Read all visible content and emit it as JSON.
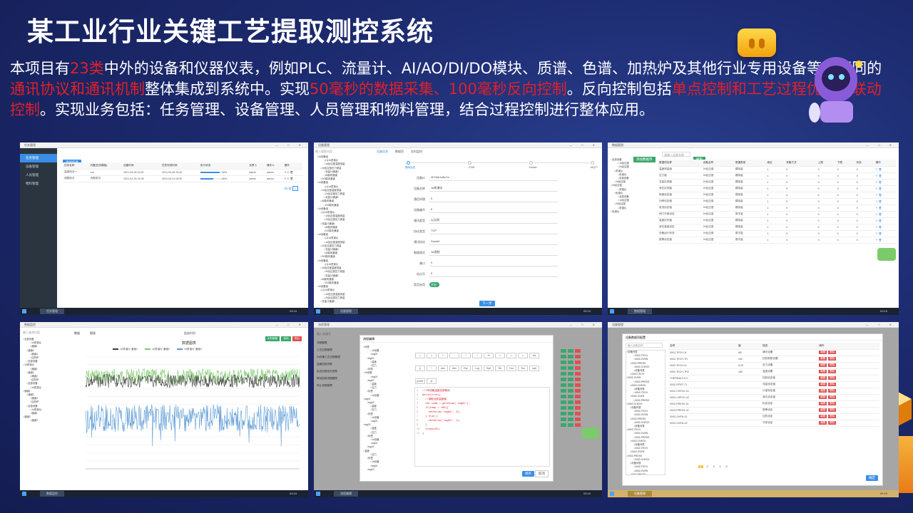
{
  "title": "某工业行业关键工艺提取测控系统",
  "description_segments": [
    {
      "text": "本项目有",
      "hl": false
    },
    {
      "text": "23类",
      "hl": true
    },
    {
      "text": "中外的设备和仪器仪表，例如PLC、流量计、AI/AO/DI/DO模块、质谱、色谱、加热炉及其他行业专用设备等，不同的",
      "hl": false
    },
    {
      "text": "通讯协议和通讯机制",
      "hl": true
    },
    {
      "text": "整体集成到系统中。实现",
      "hl": false
    },
    {
      "text": "50毫秒的数据采集、100毫秒反向控制",
      "hl": true
    },
    {
      "text": "。反向控制包括",
      "hl": false
    },
    {
      "text": "单点控制和工艺过程优化的联动控制",
      "hl": true
    },
    {
      "text": "。实现业务包括：任务管理、设备管理、人员管理和物料管理，结合过程控制进行整体应用。",
      "hl": false
    }
  ],
  "colors": {
    "highlight": "#e0202a",
    "accent_blue": "#3a8ee6",
    "accent_green": "#3aa76d"
  },
  "shot1": {
    "sidebar": [
      "任务管理",
      "设备管理",
      "人员管理",
      "物料管理"
    ],
    "add_button": "添加任务",
    "headers": [
      "任务名称",
      "内置(任务模板)",
      "创建时间",
      "任务完成时间",
      "执行状态",
      "负责人",
      "操作人",
      "操作"
    ],
    "rows": [
      [
        "温度测试一",
        "xxx",
        "2021-03-08 15:20",
        "2021-03-08 15:40",
        "90%",
        "admin",
        "admin"
      ],
      [
        "调整测试",
        "流程测试",
        "2021-02-25 14:08",
        "2021-03-01 09:30",
        "60%",
        "admin",
        "admin"
      ]
    ],
    "progress": [
      0.9,
      0.6
    ],
    "pagination": [
      "1",
      "共2条"
    ]
  },
  "shot2": {
    "search_placeholder": "输入搜索内容",
    "tabs": [
      "设备信息",
      "数据项",
      "实时监控"
    ],
    "steps": [
      "基础信息",
      "COM",
      "Socket",
      "MQTT"
    ],
    "fields": [
      [
        "设备ID",
        "4f7d4e1a5c7a..."
      ],
      [
        "设备名称",
        "1#质谱仪"
      ],
      [
        "通信间隔",
        "0"
      ],
      [
        "设备编号",
        "0"
      ],
      [
        "通讯类型",
        "以太网"
      ],
      [
        "协议类型",
        "TCP"
      ],
      [
        "通讯协议",
        "Socket"
      ],
      [
        "数据格式",
        "16进制"
      ],
      [
        "端口",
        "0"
      ],
      [
        "站点号",
        "0"
      ],
      [
        "是否启用",
        "开启"
      ]
    ],
    "next_button": "下一步",
    "task_label": "设备管理"
  },
  "shot3": {
    "search_placeholder": "请输入设备名称",
    "search_button": "搜索",
    "add_button": "添加数据项",
    "headers": [
      "数据项名称",
      "设备名称",
      "数据类型",
      "地址",
      "采集方式",
      "上限",
      "下限",
      "状态",
      "操作"
    ],
    "rows": [
      [
        "温度测量值",
        "2#反应釜",
        "模拟量"
      ],
      [
        "压力值",
        "2#反应釜",
        "模拟量"
      ],
      [
        "流量实测值",
        "2#反应釜",
        "模拟量"
      ],
      [
        "液位实测值",
        "2#反应釜",
        "模拟量"
      ],
      [
        "转速设定值",
        "2#反应釜",
        "模拟量"
      ],
      [
        "功率设定值",
        "2#反应釜",
        "模拟量"
      ],
      [
        "电流设定值",
        "2#反应釜",
        "模拟量"
      ],
      [
        "阀门开度设定",
        "2#反应釜",
        "数字量"
      ],
      [
        "温度实时值",
        "2#反应釜",
        "模拟量"
      ],
      [
        "液位高度设定",
        "2#反应釜",
        "模拟量"
      ],
      [
        "设备运行状态",
        "2#反应釜",
        "数字量"
      ],
      [
        "报警设定值",
        "2#反应釜",
        "数字量"
      ]
    ],
    "task_label": "数据管理"
  },
  "shot4": {
    "search_placeholder": "输入查询内容",
    "tabs": [
      "数据",
      "图表"
    ],
    "time_label": "起始时间",
    "buttons": [
      "实时刷新",
      "查询",
      "导出"
    ],
    "chart_title": "数据图表",
    "legend": [
      "1#质谱仪 通道1",
      "1#质谱仪 通道2",
      "1#质谱仪 通道3"
    ],
    "task_label": "数据监控"
  },
  "chart_data": {
    "type": "line",
    "title": "数据图表",
    "series": [
      {
        "name": "1#质谱仪 通道1",
        "color": "#3f3f3f"
      },
      {
        "name": "1#质谱仪 通道2",
        "color": "#7ccb6a"
      },
      {
        "name": "1#质谱仪 通道3",
        "color": "#5b9bd5"
      }
    ],
    "grid": true,
    "legend_position": "top"
  },
  "shot5": {
    "search_placeholder": "输入关键字",
    "list": [
      "流程管理",
      "工艺过程管理",
      "2#设备工艺过程管理",
      "温度控制流程",
      "反应过程优化流程",
      "联动控制流程管理",
      "停止流程管理"
    ],
    "dialog_title": "流程编辑",
    "keypad_buttons": [
      "(",
      ")",
      "+",
      "-",
      "*",
      "/",
      "%",
      ">",
      "<",
      "=",
      "&&",
      "||",
      "!",
      "abs",
      "Abs",
      "Exp",
      "Log",
      "Sqrt",
      "Sin",
      "Cos",
      "Tan",
      "sqrt",
      "power",
      "pi"
    ],
    "confirm_button": "保存",
    "cancel_button": "取消",
    "code_lines": [
      "//1号设备温度控制程序",
      "while(true){",
      "  //读取当前温度值",
      "  var temp = getValue('tag01');",
      "  if(temp > 100){",
      "    setValue('tag02', 0);",
      "  } else {",
      "    setValue('tag02', 1);",
      "  }",
      "  sleep(50);",
      "}"
    ],
    "task_label": "流程编辑"
  },
  "shot6": {
    "search_placeholder": "输入设备名称",
    "dialog_title": "设备数据项配置",
    "headers": [
      "名称",
      "值",
      "描述",
      "操作"
    ],
    "rows": [
      [
        "0002-TECH-1L",
        "AB",
        "通讯设置"
      ],
      [
        "0002-TECH-TR",
        "100",
        "控制参数设置"
      ],
      [
        "0002-TECH-2L",
        "5.00",
        "压力设置"
      ],
      [
        "0002-TECH-TR2",
        "180",
        "温度设置"
      ],
      [
        "THERMALV-0-0",
        "",
        "控制设定值"
      ],
      [
        "0002-FIRST-TL",
        "",
        "流量设定值"
      ],
      [
        "0002-CHECK-01",
        "",
        "计量标定值"
      ],
      [
        "0002-CHECK-02",
        "",
        "液位设定值"
      ],
      [
        "0002-PRESS-01",
        "",
        "标定设定"
      ],
      [
        "0002-PRESS-02",
        "",
        "报警设定"
      ],
      [
        "0002-OVEN-01",
        "",
        "加热设定"
      ],
      [
        "0002-OVEN-02",
        "",
        "冷却设定"
      ]
    ],
    "pagination": [
      "1",
      "2",
      "3",
      "4",
      "5"
    ],
    "confirm_button": "确定",
    "task_label": "设备管理"
  }
}
